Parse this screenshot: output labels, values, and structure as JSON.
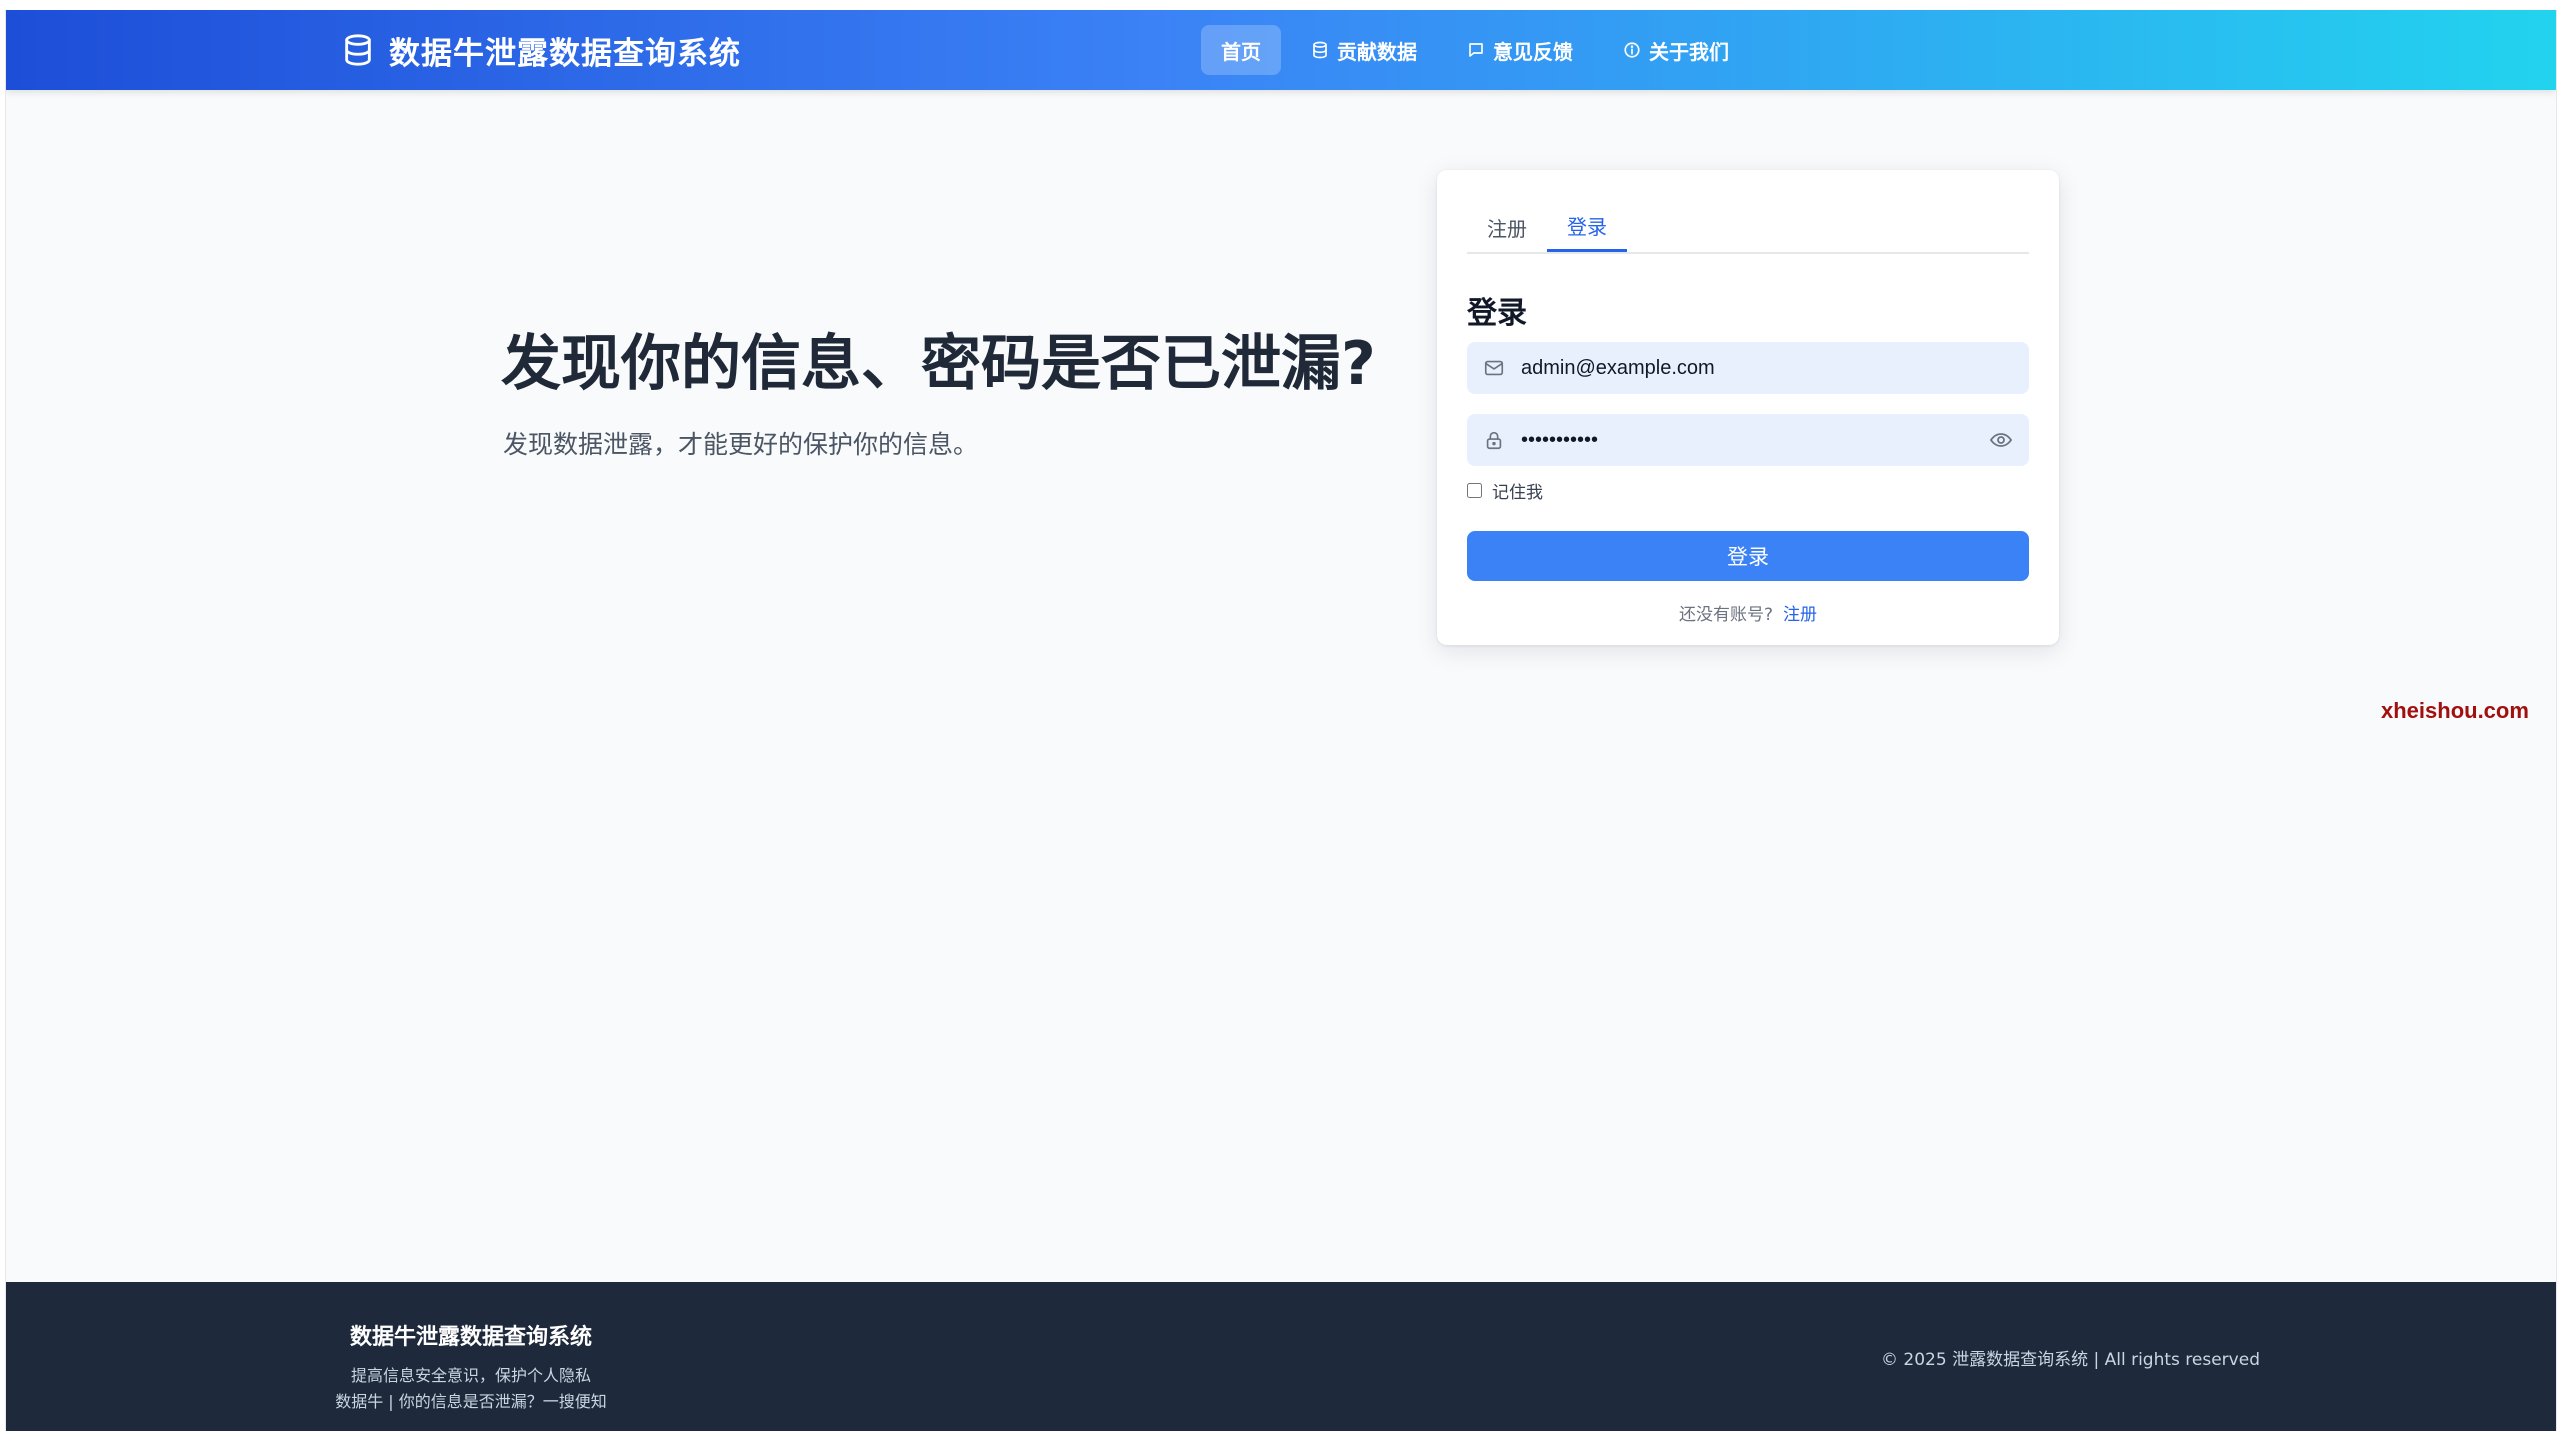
{
  "app": {
    "title": "数据牛泄露数据查询系统"
  },
  "nav": {
    "items": [
      {
        "label": "首页",
        "icon": "home"
      },
      {
        "label": "贡献数据",
        "icon": "database-icon"
      },
      {
        "label": "意见反馈",
        "icon": "message-icon"
      },
      {
        "label": "关于我们",
        "icon": "info-icon"
      }
    ],
    "active_index": 0
  },
  "hero": {
    "title": "发现你的信息、密码是否已泄漏?",
    "subtitle": "发现数据泄露，才能更好的保护你的信息。"
  },
  "login": {
    "tabs": [
      "注册",
      "登录"
    ],
    "active_tab": "登录",
    "heading": "登录",
    "email_value": "admin@example.com",
    "password_value": "•••••••••••",
    "remember_label": "记住我",
    "remember_checked": false,
    "submit_label": "登录",
    "no_account_text": "还没有账号?",
    "register_link": "注册"
  },
  "watermark": "xheishou.com",
  "footer": {
    "title": "数据牛泄露数据查询系统",
    "line1": "提高信息安全意识，保护个人隐私",
    "line2": "数据牛 | 你的信息是否泄漏？一搜便知",
    "copyright": "© 2025 泄露数据查询系统 | All rights reserved"
  },
  "colors": {
    "brand_blue": "#3b82f6",
    "link_blue": "#2563eb",
    "footer_bg": "#1e293b",
    "watermark": "#a10f0f"
  }
}
